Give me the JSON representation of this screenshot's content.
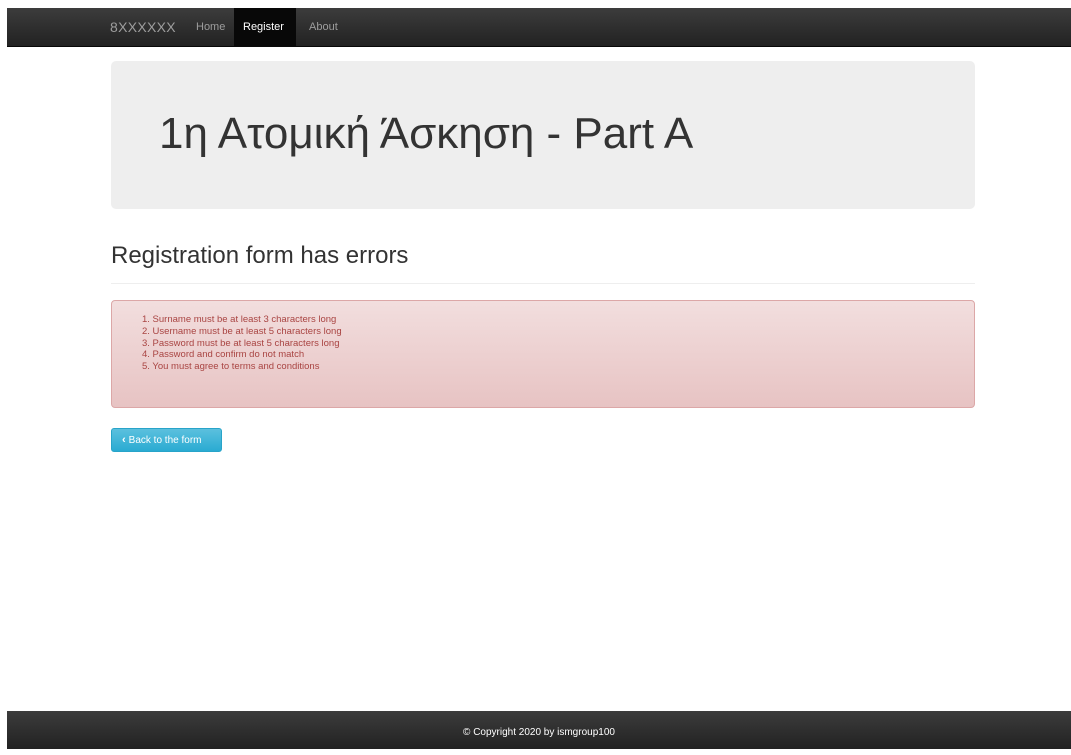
{
  "navbar": {
    "brand": "8XXXXXX",
    "items": [
      {
        "label": "Home",
        "active": false
      },
      {
        "label": "Register",
        "active": true
      },
      {
        "label": "About",
        "active": false
      }
    ]
  },
  "jumbotron": {
    "title": "1η Ατομική Άσκηση - Part A"
  },
  "main": {
    "heading": "Registration form has errors",
    "errors": [
      "1. Surname must be at least 3 characters long",
      "2. Username must be at least 5 characters long",
      "3. Password must be at least 5 characters long",
      "4. Password and confirm do not match",
      "5. You must agree to terms and conditions"
    ],
    "back_button": {
      "icon": "chevron-left-icon",
      "label": "Back to the form"
    }
  },
  "footer": {
    "text": "© Copyright 2020 by ismgroup100"
  },
  "colors": {
    "navbar": "#222222",
    "alert_bg": "#f2dede",
    "alert_text": "#a94442",
    "info_button": "#5bc0de"
  }
}
